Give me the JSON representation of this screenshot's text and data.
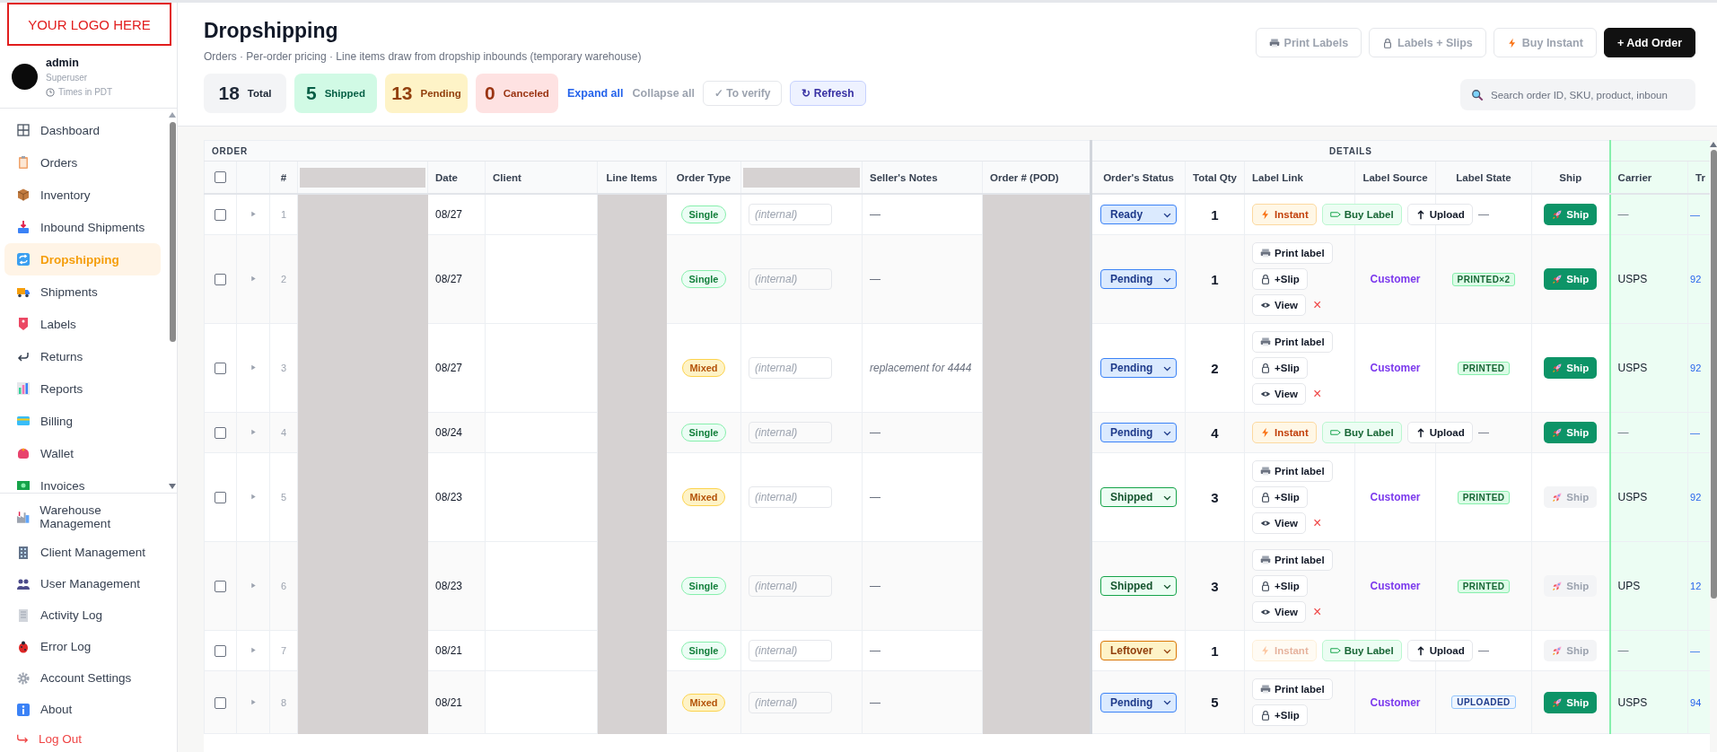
{
  "logo": {
    "text": "YOUR LOGO HERE"
  },
  "user": {
    "name": "admin",
    "role": "Superuser",
    "timezone": "Times in PDT"
  },
  "nav": {
    "items": [
      {
        "label": "Dashboard",
        "selected": false
      },
      {
        "label": "Orders",
        "selected": false
      },
      {
        "label": "Inventory",
        "selected": false
      },
      {
        "label": "Inbound Shipments",
        "selected": false
      },
      {
        "label": "Dropshipping",
        "selected": true
      },
      {
        "label": "Shipments",
        "selected": false
      },
      {
        "label": "Labels",
        "selected": false
      },
      {
        "label": "Returns",
        "selected": false
      },
      {
        "label": "Reports",
        "selected": false
      },
      {
        "label": "Billing",
        "selected": false
      },
      {
        "label": "Wallet",
        "selected": false
      },
      {
        "label": "Invoices",
        "selected": false
      }
    ],
    "bottom_items": [
      {
        "label": "Warehouse Management",
        "selected": false
      },
      {
        "label": "Client Management",
        "selected": false
      },
      {
        "label": "User Management",
        "selected": false
      },
      {
        "label": "Activity Log",
        "selected": false
      },
      {
        "label": "Error Log",
        "selected": false
      },
      {
        "label": "Account Settings",
        "selected": false
      },
      {
        "label": "About",
        "selected": false
      }
    ],
    "logout": "Log Out"
  },
  "page": {
    "title": "Dropshipping",
    "subtitle": "Orders · Per-order pricing · Line items draw from dropship inbounds (temporary warehouse)"
  },
  "actions": [
    {
      "label": "Print Labels",
      "kind": "print"
    },
    {
      "label": "Labels + Slips",
      "kind": "slips"
    },
    {
      "label": "Buy Instant",
      "kind": "instant"
    },
    {
      "label": "+ Add Order",
      "kind": "primary"
    }
  ],
  "stats": [
    {
      "value": "18",
      "label": "Total",
      "kind": "total"
    },
    {
      "value": "5",
      "label": "Shipped",
      "kind": "shipped"
    },
    {
      "value": "13",
      "label": "Pending",
      "kind": "pending"
    },
    {
      "value": "0",
      "label": "Canceled",
      "kind": "canceled"
    }
  ],
  "toolbar": [
    {
      "label": "Expand all",
      "kind": "link",
      "disabled": false
    },
    {
      "label": "Collapse all",
      "kind": "link",
      "disabled": true
    },
    {
      "label": "✓ To verify",
      "kind": "button",
      "disabled": true
    },
    {
      "label": "↻ Refresh",
      "kind": "button",
      "disabled": false
    }
  ],
  "search": {
    "placeholder": "Search order ID, SKU, product, inboun"
  },
  "table": {
    "group_headers": [
      "ORDER",
      "DETAILS"
    ],
    "columns": [
      {
        "kind": "checkbox",
        "checked": false
      },
      {
        "kind": "blank"
      },
      {
        "kind": "text",
        "label": "#"
      },
      {
        "kind": "redacted"
      },
      {
        "kind": "text",
        "label": "Date"
      },
      {
        "kind": "text",
        "label": "Client"
      },
      {
        "kind": "text",
        "label": "Line Items"
      },
      {
        "kind": "text",
        "label": "Order Type"
      },
      {
        "kind": "redacted"
      },
      {
        "kind": "text",
        "label": "Seller's Notes"
      },
      {
        "kind": "text",
        "label": "Order # (POD)"
      },
      {
        "kind": "text",
        "label": "Order's Status"
      },
      {
        "kind": "text",
        "label": "Total Qty"
      },
      {
        "kind": "text",
        "label": "Label Link"
      },
      {
        "kind": "text",
        "label": "Label Source"
      },
      {
        "kind": "text",
        "label": "Label State"
      },
      {
        "kind": "text",
        "label": "Ship"
      },
      {
        "kind": "text",
        "label": "Carrier"
      },
      {
        "kind": "text",
        "label": "Tr"
      }
    ],
    "rows": [
      {
        "checked": false,
        "num": "1",
        "date": "08/27",
        "order_type": {
          "label": "Single",
          "kind": "single"
        },
        "internal_placeholder": "(internal)",
        "notes": "—",
        "status": {
          "label": "Ready",
          "kind": "ready"
        },
        "qty": "1",
        "label_buttons": [
          {
            "label": "Instant",
            "kind": "instant",
            "disabled": false
          },
          {
            "label": "Buy Label",
            "kind": "buy",
            "disabled": false
          },
          {
            "label": "Upload",
            "kind": "upload",
            "disabled": false
          }
        ],
        "label_source": "",
        "label_state": {
          "label": "—",
          "kind": "none"
        },
        "ship": {
          "label": "Ship",
          "disabled": false
        },
        "carrier": "—",
        "tracking": "—"
      },
      {
        "checked": false,
        "num": "2",
        "date": "08/27",
        "order_type": {
          "label": "Single",
          "kind": "single"
        },
        "internal_placeholder": "(internal)",
        "notes": "—",
        "status": {
          "label": "Pending",
          "kind": "pending"
        },
        "qty": "1",
        "label_buttons": [
          {
            "label": "Print label",
            "kind": "print",
            "disabled": false
          },
          {
            "label": "+Slip",
            "kind": "slip",
            "disabled": false
          },
          {
            "label": "View",
            "kind": "view",
            "disabled": false
          },
          {
            "label": "×",
            "kind": "remove",
            "disabled": false
          }
        ],
        "label_source": "Customer",
        "label_state": {
          "label": "PRINTED×2",
          "kind": "printed"
        },
        "ship": {
          "label": "Ship",
          "disabled": false
        },
        "carrier": "USPS",
        "tracking": "92"
      },
      {
        "checked": false,
        "num": "3",
        "date": "08/27",
        "order_type": {
          "label": "Mixed",
          "kind": "mixed"
        },
        "internal_placeholder": "(internal)",
        "notes": "replacement for 4444",
        "status": {
          "label": "Pending",
          "kind": "pending"
        },
        "qty": "2",
        "label_buttons": [
          {
            "label": "Print label",
            "kind": "print",
            "disabled": false
          },
          {
            "label": "+Slip",
            "kind": "slip",
            "disabled": false
          },
          {
            "label": "View",
            "kind": "view",
            "disabled": false
          },
          {
            "label": "×",
            "kind": "remove",
            "disabled": false
          }
        ],
        "label_source": "Customer",
        "label_state": {
          "label": "PRINTED",
          "kind": "printed"
        },
        "ship": {
          "label": "Ship",
          "disabled": false
        },
        "carrier": "USPS",
        "tracking": "92"
      },
      {
        "checked": false,
        "num": "4",
        "date": "08/24",
        "order_type": {
          "label": "Single",
          "kind": "single"
        },
        "internal_placeholder": "(internal)",
        "notes": "—",
        "status": {
          "label": "Pending",
          "kind": "pending"
        },
        "qty": "4",
        "label_buttons": [
          {
            "label": "Instant",
            "kind": "instant",
            "disabled": false
          },
          {
            "label": "Buy Label",
            "kind": "buy",
            "disabled": false
          },
          {
            "label": "Upload",
            "kind": "upload",
            "disabled": false
          }
        ],
        "label_source": "",
        "label_state": {
          "label": "—",
          "kind": "none"
        },
        "ship": {
          "label": "Ship",
          "disabled": false
        },
        "carrier": "—",
        "tracking": "—"
      },
      {
        "checked": false,
        "num": "5",
        "date": "08/23",
        "order_type": {
          "label": "Mixed",
          "kind": "mixed"
        },
        "internal_placeholder": "(internal)",
        "notes": "—",
        "status": {
          "label": "Shipped",
          "kind": "shipped"
        },
        "qty": "3",
        "label_buttons": [
          {
            "label": "Print label",
            "kind": "print",
            "disabled": false
          },
          {
            "label": "+Slip",
            "kind": "slip",
            "disabled": false
          },
          {
            "label": "View",
            "kind": "view",
            "disabled": false
          },
          {
            "label": "×",
            "kind": "remove",
            "disabled": false
          }
        ],
        "label_source": "Customer",
        "label_state": {
          "label": "PRINTED",
          "kind": "printed"
        },
        "ship": {
          "label": "Ship",
          "disabled": true
        },
        "carrier": "USPS",
        "tracking": "92"
      },
      {
        "checked": false,
        "num": "6",
        "date": "08/23",
        "order_type": {
          "label": "Single",
          "kind": "single"
        },
        "internal_placeholder": "(internal)",
        "notes": "—",
        "status": {
          "label": "Shipped",
          "kind": "shipped"
        },
        "qty": "3",
        "label_buttons": [
          {
            "label": "Print label",
            "kind": "print",
            "disabled": false
          },
          {
            "label": "+Slip",
            "kind": "slip",
            "disabled": false
          },
          {
            "label": "View",
            "kind": "view",
            "disabled": false
          },
          {
            "label": "×",
            "kind": "remove",
            "disabled": false
          }
        ],
        "label_source": "Customer",
        "label_state": {
          "label": "PRINTED",
          "kind": "printed"
        },
        "ship": {
          "label": "Ship",
          "disabled": true
        },
        "carrier": "UPS",
        "tracking": "12"
      },
      {
        "checked": false,
        "num": "7",
        "date": "08/21",
        "order_type": {
          "label": "Single",
          "kind": "single"
        },
        "internal_placeholder": "(internal)",
        "notes": "—",
        "status": {
          "label": "Leftover",
          "kind": "leftover"
        },
        "qty": "1",
        "label_buttons": [
          {
            "label": "Instant",
            "kind": "instant",
            "disabled": true
          },
          {
            "label": "Buy Label",
            "kind": "buy",
            "disabled": false
          },
          {
            "label": "Upload",
            "kind": "upload",
            "disabled": false
          }
        ],
        "label_source": "",
        "label_state": {
          "label": "—",
          "kind": "none"
        },
        "ship": {
          "label": "Ship",
          "disabled": true
        },
        "carrier": "—",
        "tracking": "—"
      },
      {
        "checked": false,
        "num": "8",
        "date": "08/21",
        "order_type": {
          "label": "Mixed",
          "kind": "mixed"
        },
        "internal_placeholder": "(internal)",
        "notes": "—",
        "status": {
          "label": "Pending",
          "kind": "pending"
        },
        "qty": "5",
        "label_buttons": [
          {
            "label": "Print label",
            "kind": "print",
            "disabled": false
          },
          {
            "label": "+Slip",
            "kind": "slip",
            "disabled": false
          }
        ],
        "label_source": "Customer",
        "label_state": {
          "label": "UPLOADED",
          "kind": "uploaded"
        },
        "ship": {
          "label": "Ship",
          "disabled": false
        },
        "carrier": "USPS",
        "tracking": "94"
      }
    ]
  }
}
